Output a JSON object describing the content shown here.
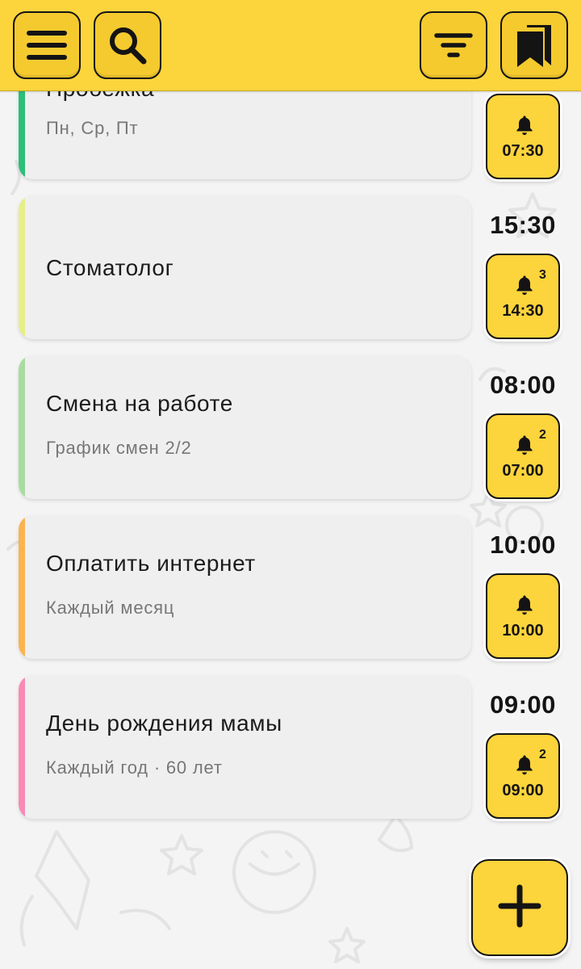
{
  "toolbar": {
    "menu_icon": "hamburger-menu-icon",
    "search_icon": "search-icon",
    "filter_icon": "filter-icon",
    "bookmarks_icon": "bookmarks-icon",
    "accent_color": "#FCD43C"
  },
  "reminders": [
    {
      "title": "Пробежка",
      "subtitle": "Пн, Ср, Пт",
      "event_time": "",
      "stripe_color": "#2BBF7A",
      "alarm_time": "07:30",
      "alarm_count": ""
    },
    {
      "title": "Стоматолог",
      "subtitle": "",
      "event_time": "15:30",
      "stripe_color": "#E8EE88",
      "alarm_time": "14:30",
      "alarm_count": "3"
    },
    {
      "title": "Смена на работе",
      "subtitle": "График смен 2/2",
      "event_time": "08:00",
      "stripe_color": "#A8DCA0",
      "alarm_time": "07:00",
      "alarm_count": "2"
    },
    {
      "title": "Оплатить интернет",
      "subtitle": "Каждый месяц",
      "event_time": "10:00",
      "stripe_color": "#FBB34E",
      "alarm_time": "10:00",
      "alarm_count": ""
    },
    {
      "title": "День рождения мамы",
      "subtitle": "Каждый год · 60 лет",
      "event_time": "09:00",
      "stripe_color": "#F78BB4",
      "alarm_time": "09:00",
      "alarm_count": "2"
    }
  ],
  "fab": {
    "icon": "plus-icon"
  }
}
